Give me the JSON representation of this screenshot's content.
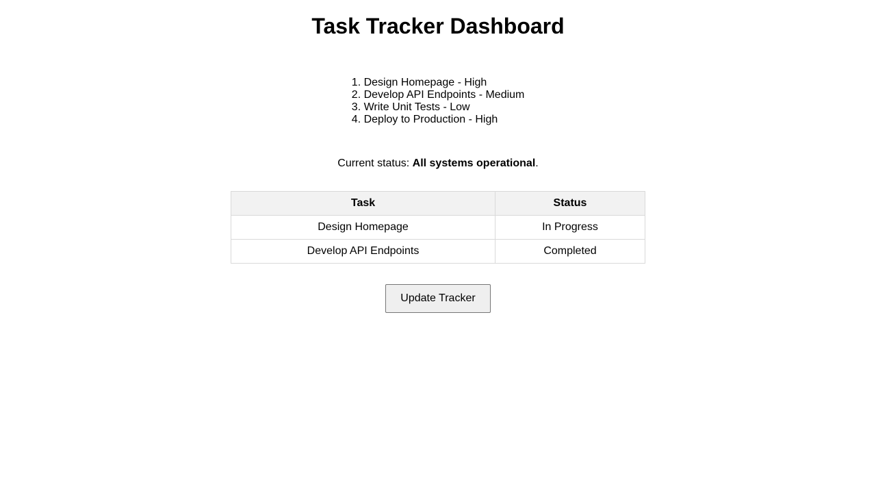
{
  "page": {
    "title": "Task Tracker Dashboard"
  },
  "tasks": [
    {
      "label": "Design Homepage - High"
    },
    {
      "label": "Develop API Endpoints - Medium"
    },
    {
      "label": "Write Unit Tests - Low"
    },
    {
      "label": "Deploy to Production - High"
    }
  ],
  "status": {
    "prefix": "Current status: ",
    "value": "All systems operational",
    "suffix": "."
  },
  "table": {
    "headers": [
      "Task",
      "Status"
    ],
    "rows": [
      [
        "Design Homepage",
        "In Progress"
      ],
      [
        "Develop API Endpoints",
        "Completed"
      ]
    ]
  },
  "actions": {
    "update_label": "Update Tracker"
  }
}
